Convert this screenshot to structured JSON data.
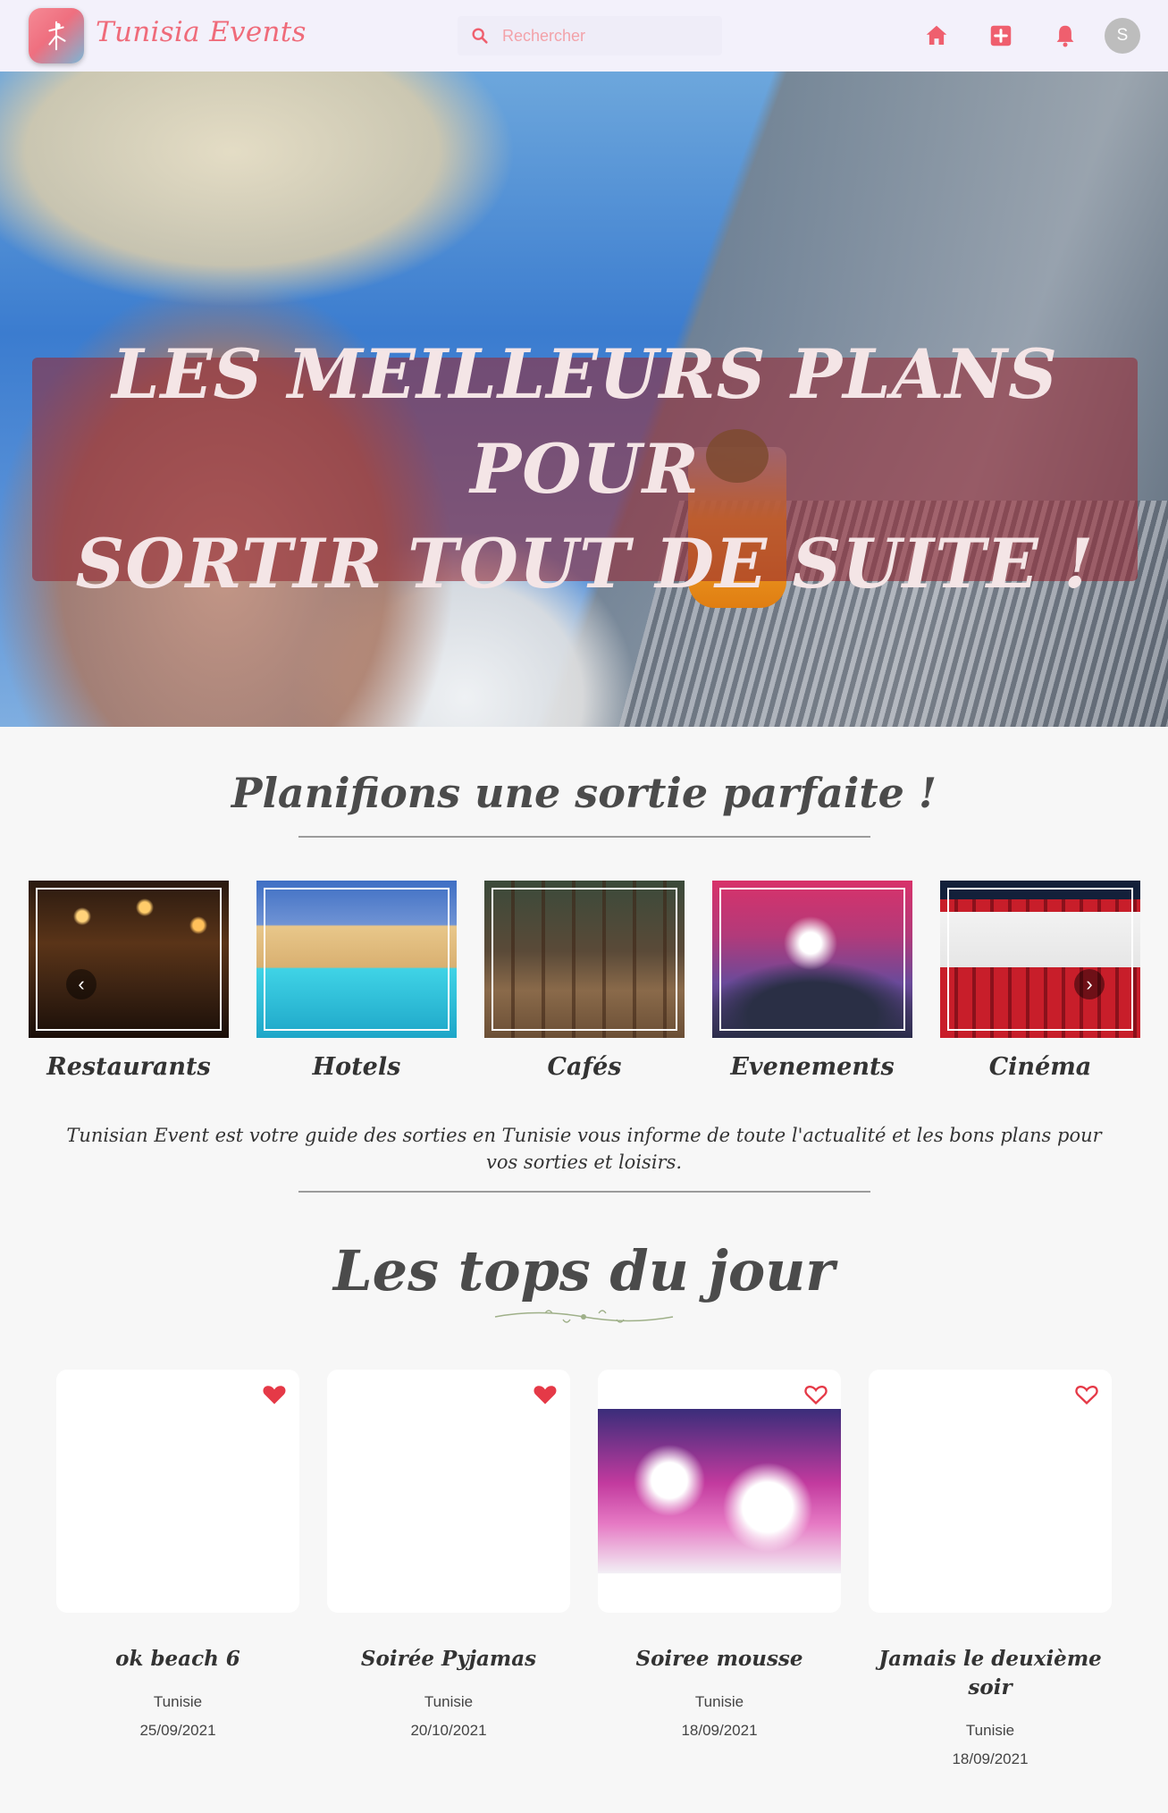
{
  "navbar": {
    "brand": "Tunisia Events",
    "search_placeholder": "Rechercher",
    "avatar_initial": "S",
    "icons": [
      "home-icon",
      "add-box-icon",
      "bell-icon"
    ],
    "accent_color": "#ef5f6e"
  },
  "hero": {
    "title_line1": "LES MEILLEURS PLANS POUR",
    "title_line2": "SORTIR TOUT DE SUITE !",
    "slides": 4,
    "active_slide": 4
  },
  "plan": {
    "title": "Planifions une sortie parfaite !",
    "categories": [
      {
        "label": "Restaurants"
      },
      {
        "label": "Hotels"
      },
      {
        "label": "Cafés"
      },
      {
        "label": "Evenements"
      },
      {
        "label": "Cinéma"
      }
    ],
    "prev_glyph": "‹",
    "next_glyph": "›",
    "guide_text": "Tunisian Event est votre guide des sorties en Tunisie vous informe de toute l'actualité et les bons plans pour vos sorties et loisirs."
  },
  "tops": {
    "title": "Les tops du jour",
    "cards": [
      {
        "name": "ok beach 6",
        "location": "Tunisie",
        "date": "25/09/2021",
        "favorite": true
      },
      {
        "name": "Soirée Pyjamas",
        "location": "Tunisie",
        "date": "20/10/2021",
        "favorite": true
      },
      {
        "name": "Soiree mousse",
        "location": "Tunisie",
        "date": "18/09/2021",
        "favorite": false
      },
      {
        "name": "Jamais le deuxième soir",
        "location": "Tunisie",
        "date": "18/09/2021",
        "favorite": false
      }
    ]
  }
}
